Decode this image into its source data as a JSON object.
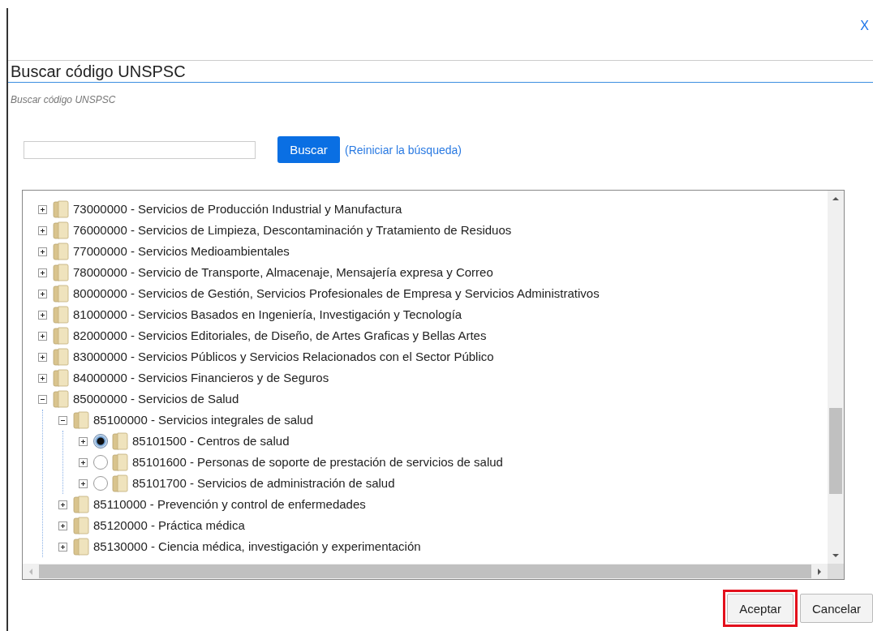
{
  "dialog": {
    "close": "X",
    "title": "Buscar código UNSPSC",
    "subtitle": "Buscar código UNSPSC"
  },
  "search": {
    "button": "Buscar",
    "reset_link": "(Reiniciar la búsqueda)"
  },
  "tree": {
    "items": [
      {
        "label": "73000000 - Servicios de Producción Industrial y Manufactura",
        "expanded": false
      },
      {
        "label": "76000000 - Servicios de Limpieza, Descontaminación y Tratamiento de Residuos",
        "expanded": false
      },
      {
        "label": "77000000 - Servicios Medioambientales",
        "expanded": false
      },
      {
        "label": "78000000 - Servicio de Transporte, Almacenaje, Mensajería expresa y Correo",
        "expanded": false
      },
      {
        "label": "80000000 - Servicios de Gestión, Servicios Profesionales de Empresa y Servicios Administrativos",
        "expanded": false
      },
      {
        "label": "81000000 - Servicios Basados en Ingeniería, Investigación y Tecnología",
        "expanded": false
      },
      {
        "label": "82000000 - Servicios Editoriales, de Diseño, de Artes Graficas y Bellas Artes",
        "expanded": false
      },
      {
        "label": "83000000 - Servicios Públicos y Servicios Relacionados con el Sector Público",
        "expanded": false
      },
      {
        "label": "84000000 - Servicios Financieros y de Seguros",
        "expanded": false
      },
      {
        "label": "85000000 - Servicios de Salud",
        "expanded": true,
        "children": [
          {
            "label": "85100000 - Servicios integrales de salud",
            "expanded": true,
            "children": [
              {
                "label": "85101500 - Centros de salud",
                "expanded": false,
                "selected": true
              },
              {
                "label": "85101600 - Personas de soporte de prestación de servicios de salud",
                "expanded": false,
                "selected": false
              },
              {
                "label": "85101700 - Servicios de administración de salud",
                "expanded": false,
                "selected": false
              }
            ]
          },
          {
            "label": "85110000 - Prevención y control de enfermedades",
            "expanded": false
          },
          {
            "label": "85120000 - Práctica médica",
            "expanded": false
          },
          {
            "label": "85130000 - Ciencia médica, investigación y experimentación",
            "expanded": false
          }
        ]
      }
    ]
  },
  "buttons": [
    {
      "label": "Aceptar",
      "highlighted": true
    },
    {
      "label": "Cancelar",
      "highlighted": false
    }
  ]
}
